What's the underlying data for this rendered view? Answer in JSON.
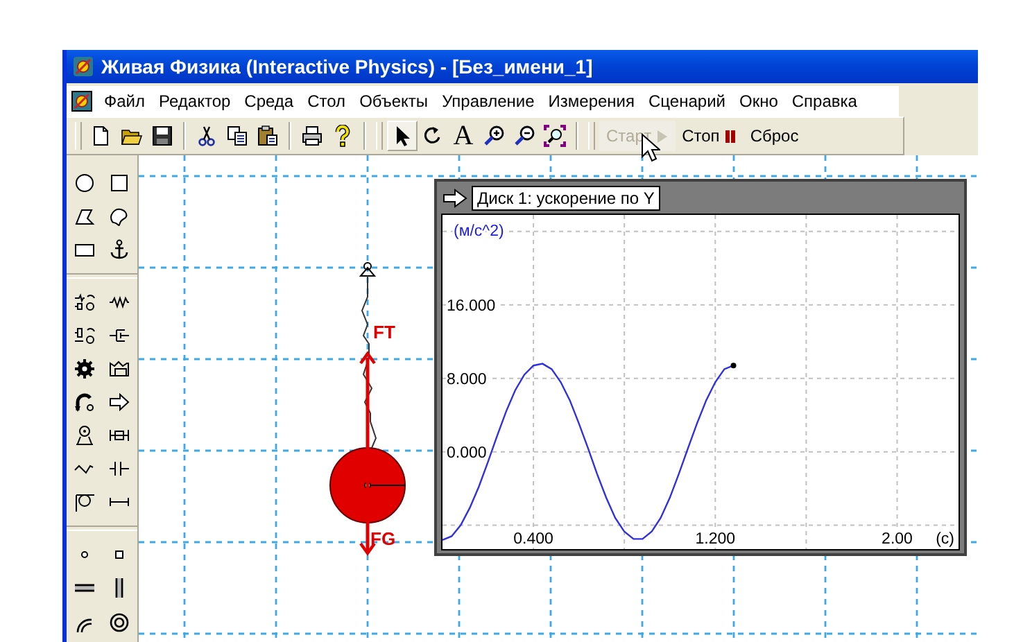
{
  "window": {
    "title": "Живая Физика (Interactive Physics) - [Без_имени_1]"
  },
  "menu": [
    "Файл",
    "Редактор",
    "Среда",
    "Стол",
    "Объекты",
    "Управление",
    "Измерения",
    "Сценарий",
    "Окно",
    "Справка"
  ],
  "toolbar": {
    "text_tool": "A"
  },
  "run_controls": [
    {
      "kind": "start",
      "label": "Старт",
      "disabled": true
    },
    {
      "kind": "stop",
      "label": "Стоп",
      "disabled": false
    },
    {
      "kind": "reset",
      "label": "Сброс",
      "disabled": false
    }
  ],
  "canvas": {
    "vectors": [
      {
        "label": "FT"
      },
      {
        "label": "FG"
      }
    ]
  },
  "graph": {
    "title": "Диск 1: ускорение по Y",
    "chart_data": {
      "type": "line",
      "ylabel": "(м/с^2)",
      "xlabel": "(c)",
      "x": [
        0,
        0.04,
        0.08,
        0.12,
        0.16,
        0.2,
        0.24,
        0.28,
        0.32,
        0.36,
        0.4,
        0.44,
        0.48,
        0.52,
        0.56,
        0.6,
        0.64,
        0.68,
        0.72,
        0.76,
        0.8,
        0.84,
        0.88,
        0.92,
        0.96,
        1.0,
        1.04,
        1.08,
        1.12,
        1.16,
        1.2,
        1.24,
        1.28
      ],
      "series": [
        {
          "color": "#3030e0",
          "values": [
            -9.6,
            -9.2,
            -8.0,
            -6.1,
            -3.8,
            -1.1,
            1.7,
            4.4,
            6.7,
            8.4,
            9.4,
            9.6,
            9.0,
            7.6,
            5.6,
            3.1,
            0.4,
            -2.4,
            -5.0,
            -7.2,
            -8.7,
            -9.5,
            -9.5,
            -8.7,
            -7.2,
            -5.0,
            -2.4,
            0.4,
            3.1,
            5.6,
            7.6,
            9.0,
            9.4
          ]
        }
      ],
      "grid": true,
      "xlim": [
        0,
        2.27
      ],
      "ylim": [
        -10.6,
        25.8
      ],
      "xticks": [
        {
          "value": 0.4,
          "label": "0.400"
        },
        {
          "value": 1.2,
          "label": "1.200"
        },
        {
          "value": 2.0,
          "label": "2.00"
        }
      ],
      "yticks": [
        {
          "value": 16,
          "label": "16.000"
        },
        {
          "value": 8,
          "label": "8.000"
        },
        {
          "value": 0,
          "label": "0.000"
        }
      ]
    }
  }
}
